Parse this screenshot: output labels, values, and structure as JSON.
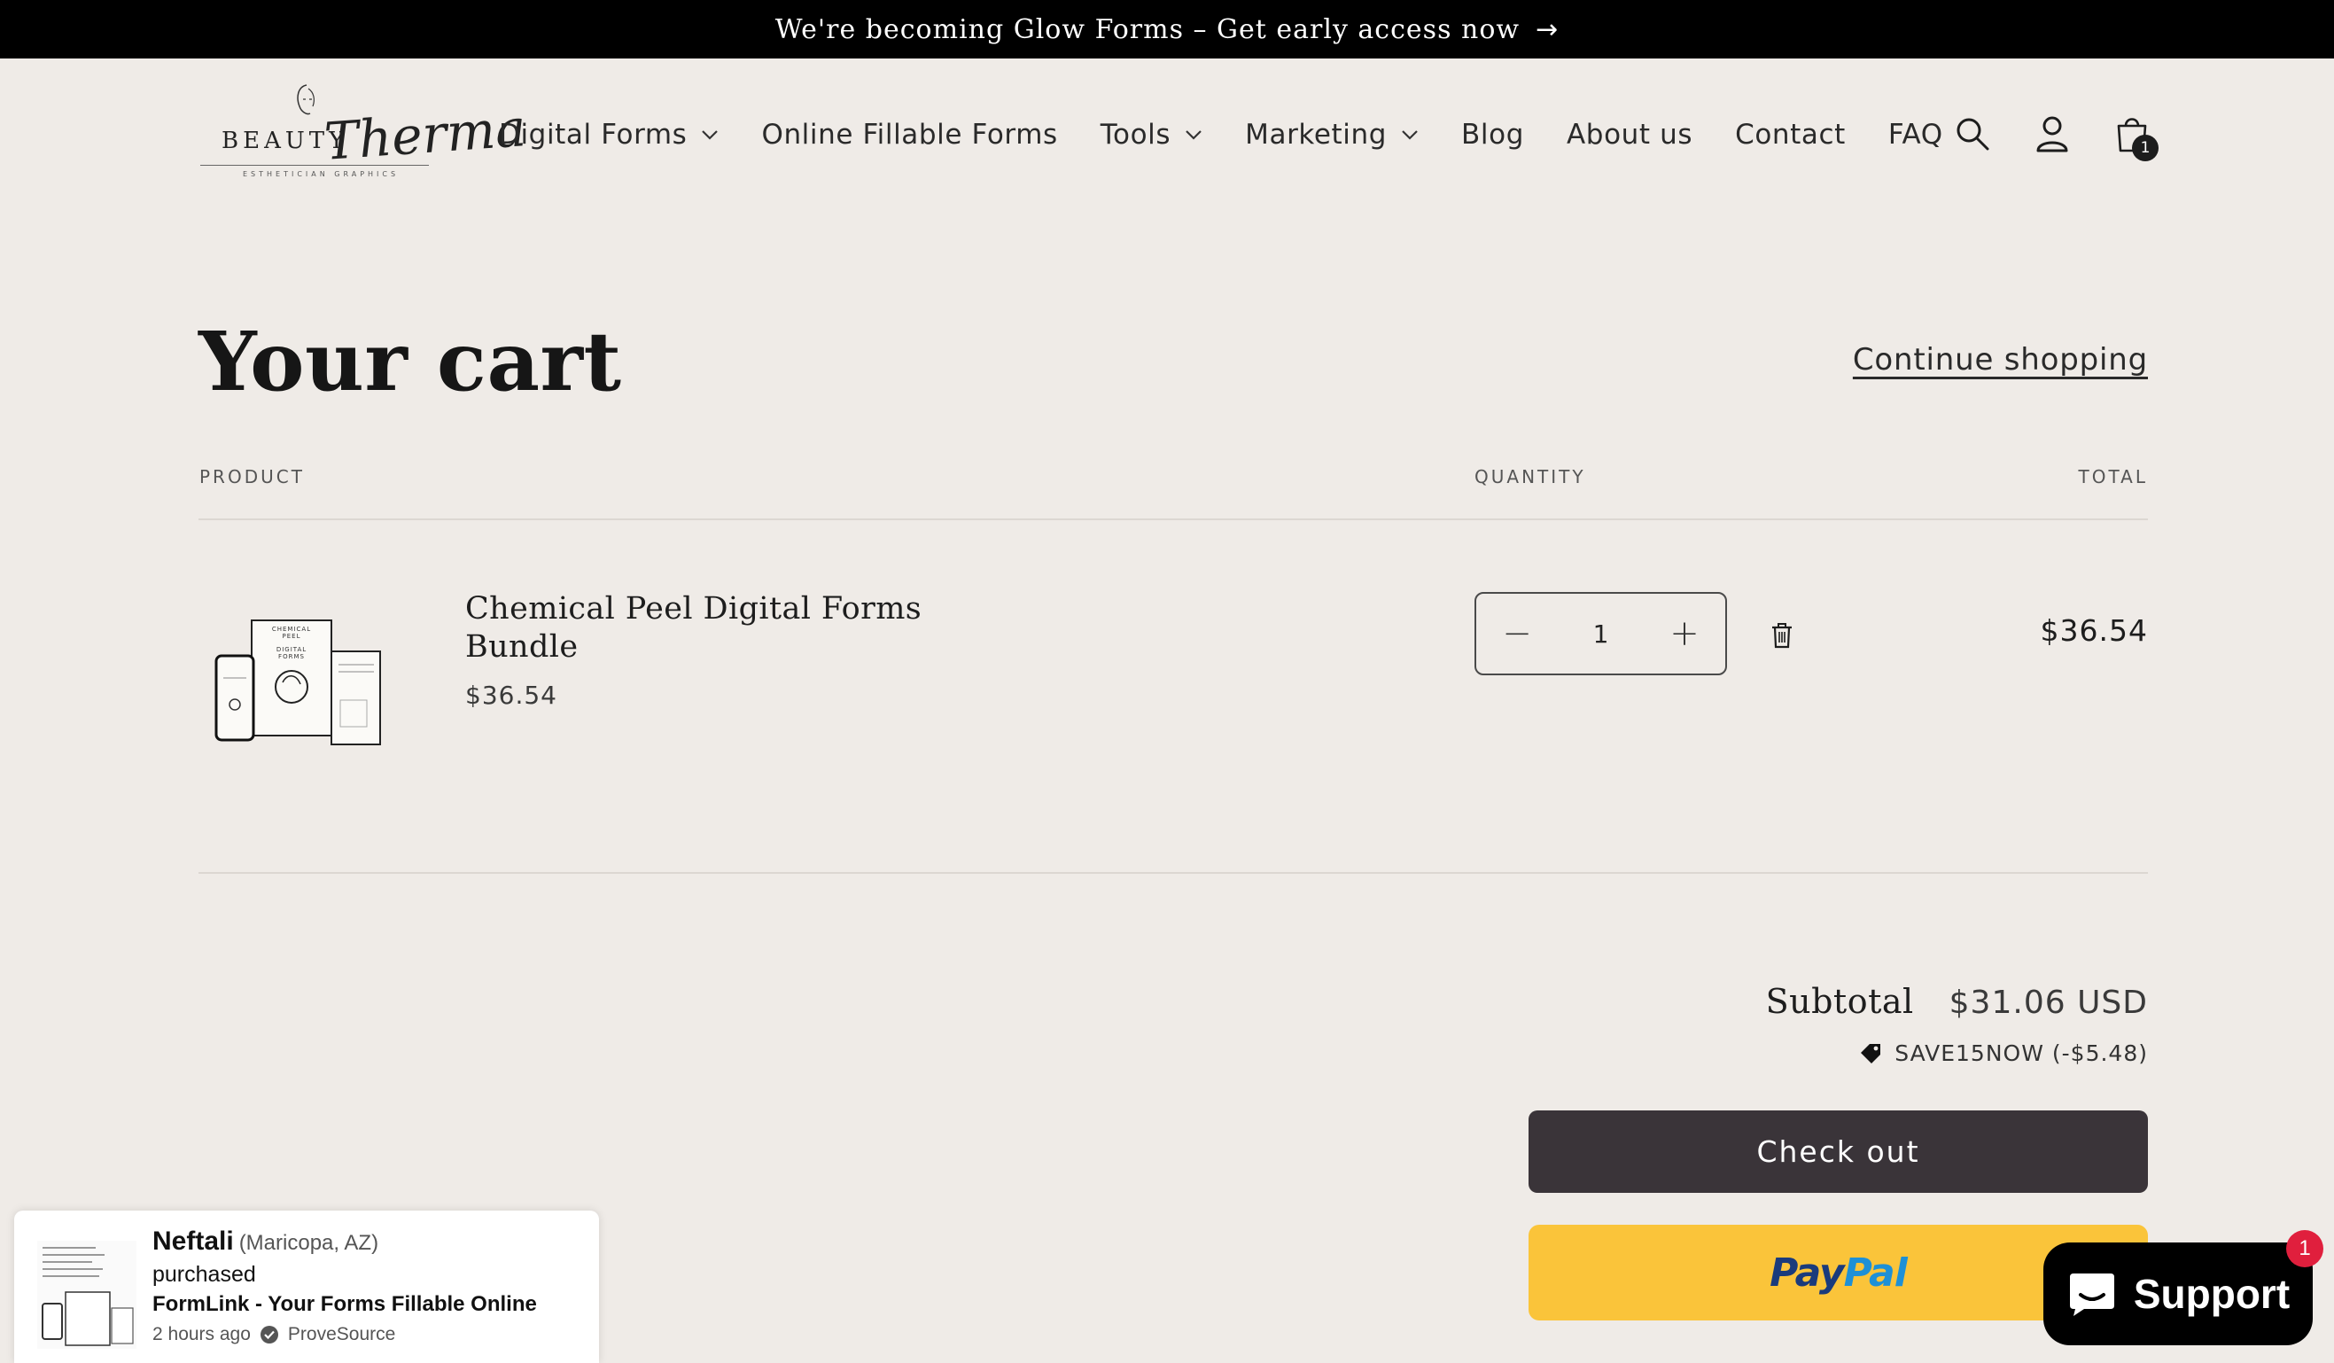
{
  "announcement": {
    "text": "We're becoming Glow Forms – Get early access now",
    "arrow": "→"
  },
  "logo": {
    "brand_left": "BEAUTY",
    "brand_script": "Therma",
    "tagline": "ESTHETICIAN GRAPHICS"
  },
  "nav": {
    "items": [
      {
        "label": "Digital Forms",
        "has_dropdown": true
      },
      {
        "label": "Online Fillable Forms",
        "has_dropdown": false
      },
      {
        "label": "Tools",
        "has_dropdown": true
      },
      {
        "label": "Marketing",
        "has_dropdown": true
      },
      {
        "label": "Blog",
        "has_dropdown": false
      },
      {
        "label": "About us",
        "has_dropdown": false
      },
      {
        "label": "Contact",
        "has_dropdown": false
      },
      {
        "label": "FAQ",
        "has_dropdown": false
      }
    ]
  },
  "header_icons": {
    "search": "search-icon",
    "account": "account-icon",
    "cart": "cart-icon",
    "cart_count": "1"
  },
  "cart": {
    "title": "Your cart",
    "continue_shopping": "Continue shopping",
    "columns": {
      "product": "PRODUCT",
      "quantity": "QUANTITY",
      "total": "TOTAL"
    },
    "items": [
      {
        "name": "Chemical Peel Digital Forms Bundle",
        "price": "$36.54",
        "quantity": "1",
        "total": "$36.54",
        "image_text": {
          "line1": "CHEMICAL",
          "line2": "PEEL",
          "line3": "DIGITAL",
          "line4": "FORMS"
        }
      }
    ],
    "subtotal_label": "Subtotal",
    "subtotal_value": "$31.06 USD",
    "discount": "SAVE15NOW (-$5.48)",
    "checkout_label": "Check out",
    "paypal": {
      "pay": "Pay",
      "pal": "Pal"
    }
  },
  "support": {
    "label": "Support",
    "badge": "1"
  },
  "toast": {
    "name": "Neftali",
    "location": "(Maricopa, AZ)",
    "action": "purchased",
    "product": "FormLink - Your Forms Fillable Online",
    "time": "2 hours ago",
    "source": "ProveSource"
  },
  "colors": {
    "background": "#efebe7",
    "announcement_bg": "#000000",
    "checkout_bg": "#3a3439",
    "paypal_bg": "#fac43a",
    "support_bg": "#000000",
    "badge_red": "#e01f3d"
  }
}
